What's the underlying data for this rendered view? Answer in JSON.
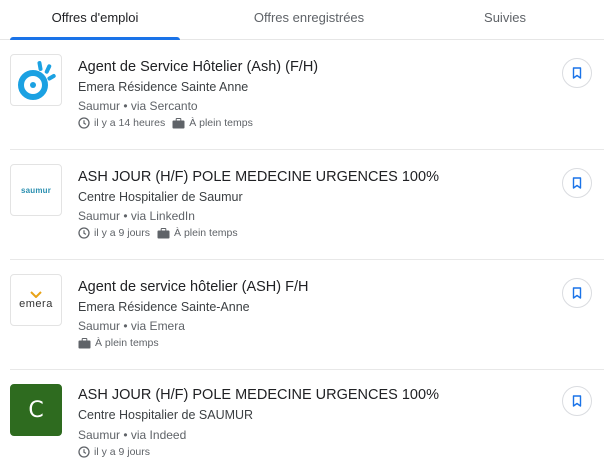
{
  "tabs": [
    {
      "label": "Offres d'emploi",
      "active": true
    },
    {
      "label": "Offres enregistrées",
      "active": false
    },
    {
      "label": "Suivies",
      "active": false
    }
  ],
  "accent_color": "#1a73e8",
  "icons": {
    "time": "clock-icon",
    "job_type": "briefcase-icon",
    "save": "bookmark-icon"
  },
  "jobs": [
    {
      "title": "Agent de Service Hôtelier (Ash) (F/H)",
      "company": "Emera Résidence Sainte Anne",
      "location": "Saumur • via Sercanto",
      "posted": "il y a 14 heures",
      "type": "À plein temps",
      "logo": {
        "style": "target-mark",
        "color": "#1ba1e2"
      }
    },
    {
      "title": "ASH JOUR (H/F) POLE MEDECINE URGENCES 100%",
      "company": "Centre Hospitalier de Saumur",
      "location": "Saumur • via LinkedIn",
      "posted": "il y a 9 jours",
      "type": "À plein temps",
      "logo": {
        "style": "wordmark",
        "text": "saumur",
        "color": "#2a8fb0"
      }
    },
    {
      "title": "Agent de service hôtelier (ASH) F/H",
      "company": "Emera Résidence Sainte-Anne",
      "location": "Saumur • via Emera",
      "posted": "",
      "type": "À plein temps",
      "logo": {
        "style": "wordmark",
        "text": "emera",
        "color": "#e8a317"
      }
    },
    {
      "title": "ASH JOUR (H/F) POLE MEDECINE URGENCES 100%",
      "company": "Centre Hospitalier de SAUMUR",
      "location": "Saumur • via Indeed",
      "posted": "il y a 9 jours",
      "type": "",
      "logo": {
        "style": "letter",
        "text": "C",
        "color": "#2e6b1f"
      }
    }
  ]
}
